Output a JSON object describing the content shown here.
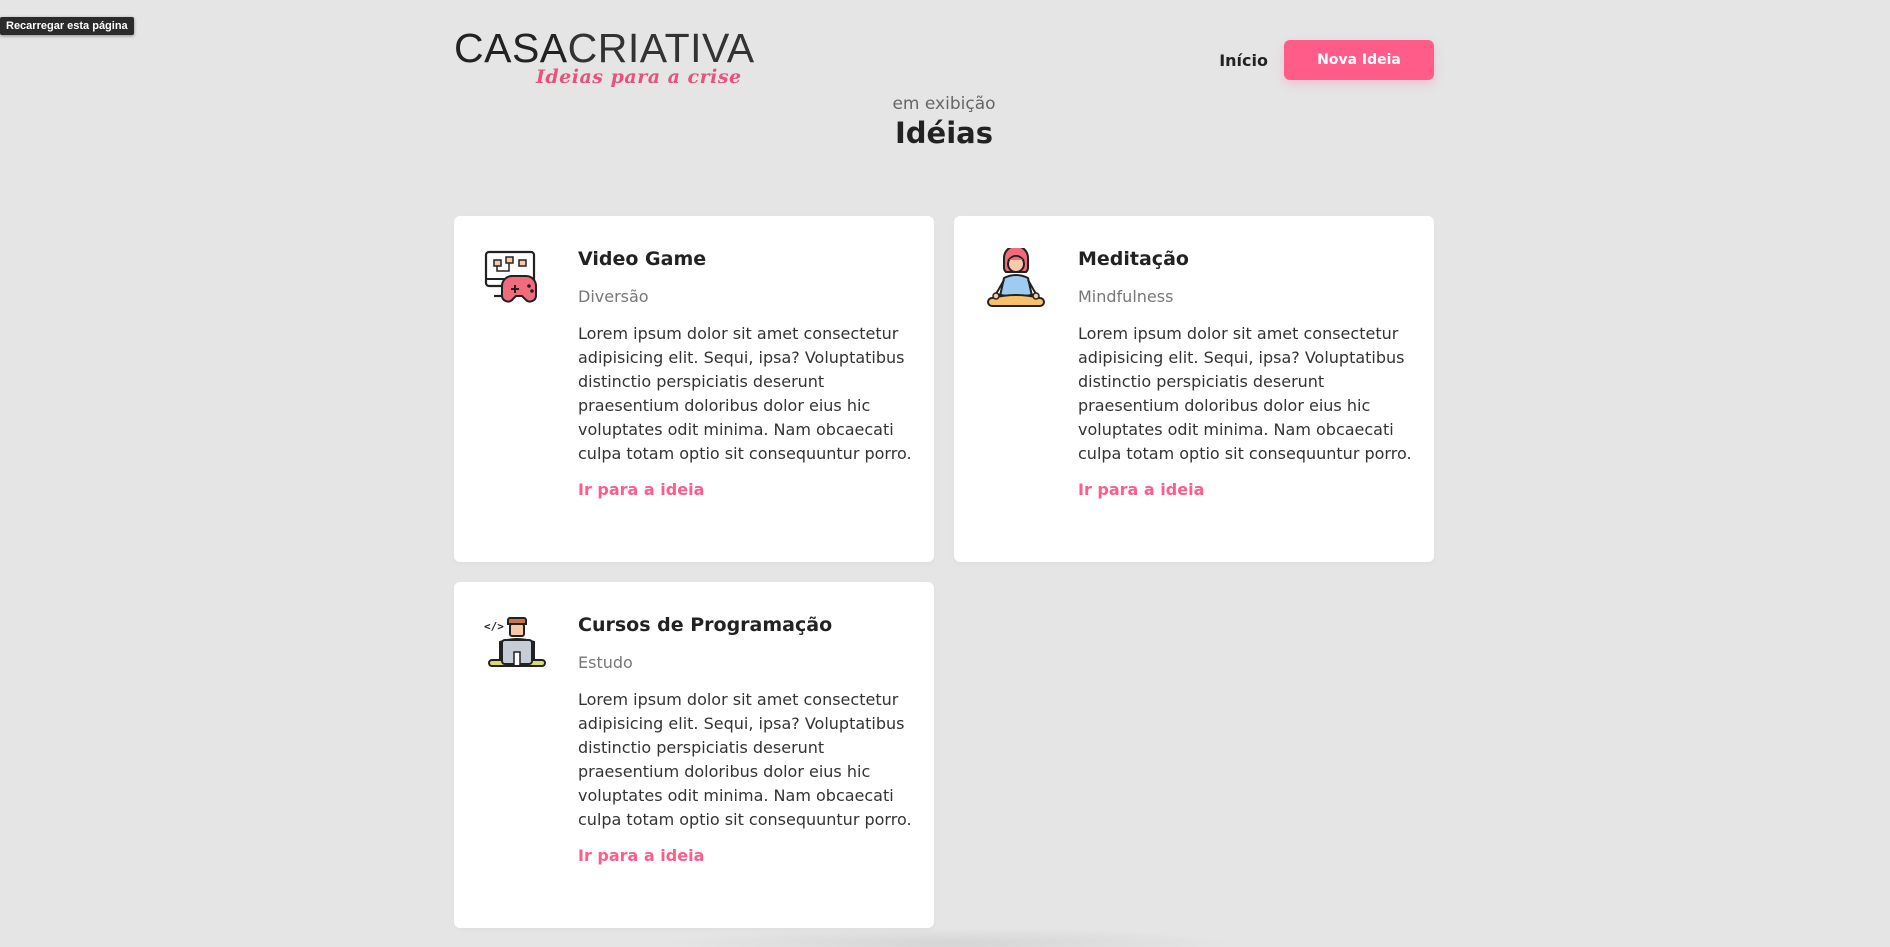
{
  "browser": {
    "tooltip": "Recarregar esta página"
  },
  "logo": {
    "part_bold": "CASA",
    "part_light": "CRIATIVA",
    "tagline": "Ideias para a crise"
  },
  "nav": {
    "home": "Início",
    "new_idea": "Nova Ideia"
  },
  "heading": {
    "subtitle": "em exibição",
    "title": "Idéias"
  },
  "colors": {
    "accent": "#ff5c8a",
    "background": "#e5e5e5",
    "card": "#ffffff"
  },
  "ideas": [
    {
      "icon": "video-game-icon",
      "title": "Video Game",
      "category": "Diversão",
      "description": "Lorem ipsum dolor sit amet consectetur adipisicing elit. Sequi, ipsa? Voluptatibus distinctio perspiciatis deserunt praesentium doloribus dolor eius hic voluptates odit minima. Nam obcaecati culpa totam optio sit consequuntur porro.",
      "link": "Ir para a ideia"
    },
    {
      "icon": "meditation-icon",
      "title": "Meditação",
      "category": "Mindfulness",
      "description": "Lorem ipsum dolor sit amet consectetur adipisicing elit. Sequi, ipsa? Voluptatibus distinctio perspiciatis deserunt praesentium doloribus dolor eius hic voluptates odit minima. Nam obcaecati culpa totam optio sit consequuntur porro.",
      "link": "Ir para a ideia"
    },
    {
      "icon": "programming-course-icon",
      "title": "Cursos de Programação",
      "category": "Estudo",
      "description": "Lorem ipsum dolor sit amet consectetur adipisicing elit. Sequi, ipsa? Voluptatibus distinctio perspiciatis deserunt praesentium doloribus dolor eius hic voluptates odit minima. Nam obcaecati culpa totam optio sit consequuntur porro.",
      "link": "Ir para a ideia"
    }
  ]
}
